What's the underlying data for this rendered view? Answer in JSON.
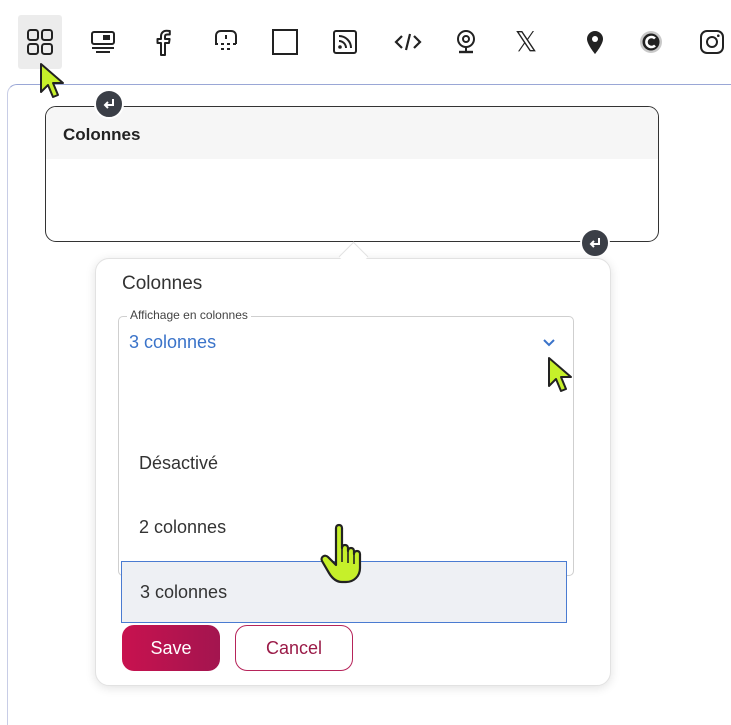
{
  "toolbar": {
    "items": [
      {
        "name": "columns-icon",
        "active": true
      },
      {
        "name": "embed-icon"
      },
      {
        "name": "facebook-icon"
      },
      {
        "name": "snippet-icon"
      },
      {
        "name": "square-icon"
      },
      {
        "name": "rss-icon"
      },
      {
        "name": "code-icon"
      },
      {
        "name": "webcam-icon"
      },
      {
        "name": "x-icon",
        "glyph": "𝕏"
      },
      {
        "name": "location-pin-icon"
      },
      {
        "name": "c-logo-icon"
      },
      {
        "name": "instagram-icon"
      }
    ]
  },
  "block": {
    "title": "Colonnes"
  },
  "popover": {
    "title": "Colonnes",
    "field_legend": "Affichage en colonnes",
    "selected_value": "3 colonnes",
    "options": [
      "Désactivé",
      "2 colonnes",
      "3 colonnes"
    ],
    "selected_index": 2,
    "save_label": "Save",
    "cancel_label": "Cancel"
  },
  "colors": {
    "accent": "#3a73c9",
    "save": "#c8124f",
    "cancel_border": "#b6245a",
    "cursor": "#c6f02a"
  }
}
